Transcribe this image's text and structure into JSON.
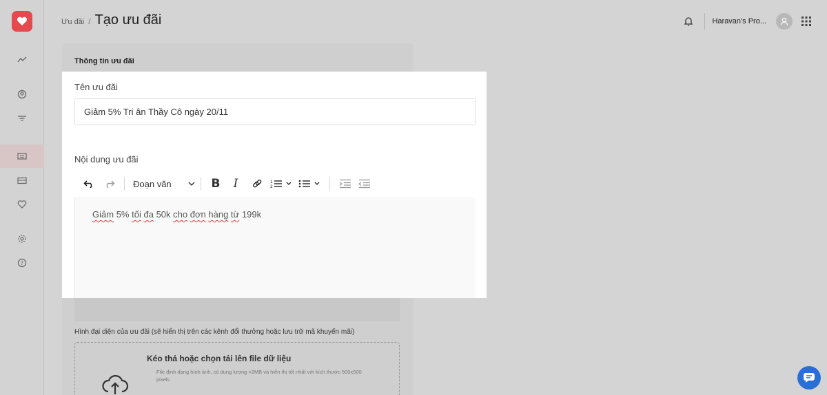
{
  "header": {
    "breadcrumb_parent": "Ưu đãi",
    "breadcrumb_sep": "/",
    "title": "Tạo ưu đãi",
    "org_name": "Haravan's Pro..."
  },
  "sidebar": {
    "items": [
      "analytics-icon",
      "customer-icon",
      "filter-icon",
      "voucher-icon",
      "mail-icon",
      "heart-icon",
      "settings-icon",
      "help-icon"
    ],
    "active": "voucher-icon"
  },
  "card": {
    "title": "Thông tin ưu đãi",
    "image_label": "Hình đại diện của ưu đãi (sẽ hiển thị trên các kênh đổi thưởng hoặc lưu trữ mã khuyến mãi)",
    "dropzone_title": "Kéo thả hoặc chọn tải lên file dữ liệu",
    "dropzone_desc": "File định dạng hình ảnh, có dung lượng <2MB và hiển thị tốt nhất với kích thước 500x500 pixels"
  },
  "form": {
    "name_label": "Tên ưu đãi",
    "name_value": "Giảm 5% Tri ân Thầy Cô ngày 20/11",
    "content_label": "Nội dung ưu đãi",
    "paragraph_style": "Đoạn văn",
    "content_words": [
      "Giảm",
      "5%",
      "tối",
      "đa",
      "50k",
      "cho",
      "đơn",
      "hàng",
      "từ",
      "199k"
    ]
  },
  "colors": {
    "brand": "#e5484d",
    "chat": "#2a6fd6"
  }
}
